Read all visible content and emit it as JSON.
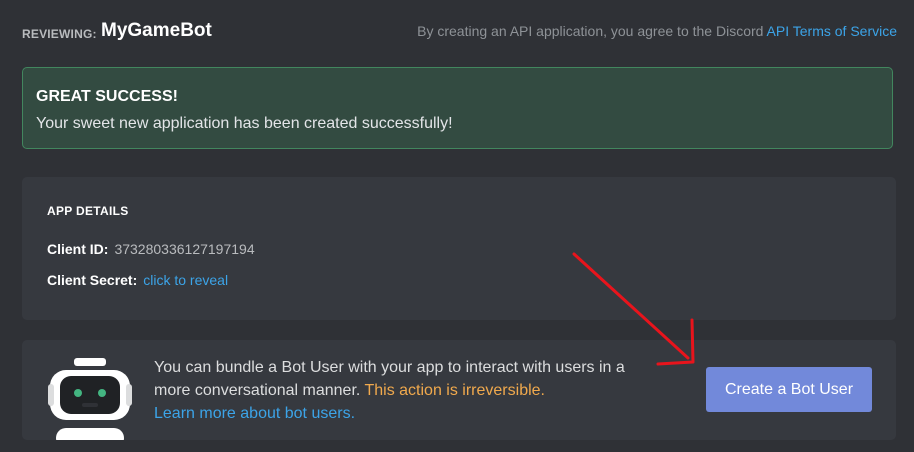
{
  "header": {
    "reviewing_label": "REVIEWING:",
    "app_name": "MyGameBot",
    "tos_text": "By creating an API application, you agree to the Discord ",
    "tos_link": "API Terms of Service"
  },
  "success": {
    "title": "GREAT SUCCESS!",
    "message": "Your sweet new application has been created successfully!"
  },
  "app_details": {
    "title": "APP DETAILS",
    "client_id_label": "Client ID:",
    "client_id_value": "373280336127197194",
    "client_secret_label": "Client Secret:",
    "client_secret_link": "click to reveal"
  },
  "bot_section": {
    "icon": "robot-icon",
    "text": "You can bundle a Bot User with your app to interact with users in a more conversational manner. ",
    "warning": "This action is irreversible.",
    "learn_link": "Learn more about bot users.",
    "create_button": "Create a Bot User"
  },
  "colors": {
    "accent": "#7289da",
    "link": "#3ca4e8",
    "success_bg": "#334b41",
    "success_border": "#42865e",
    "warning": "#f0a94d",
    "annotation_arrow": "#e8141c"
  }
}
